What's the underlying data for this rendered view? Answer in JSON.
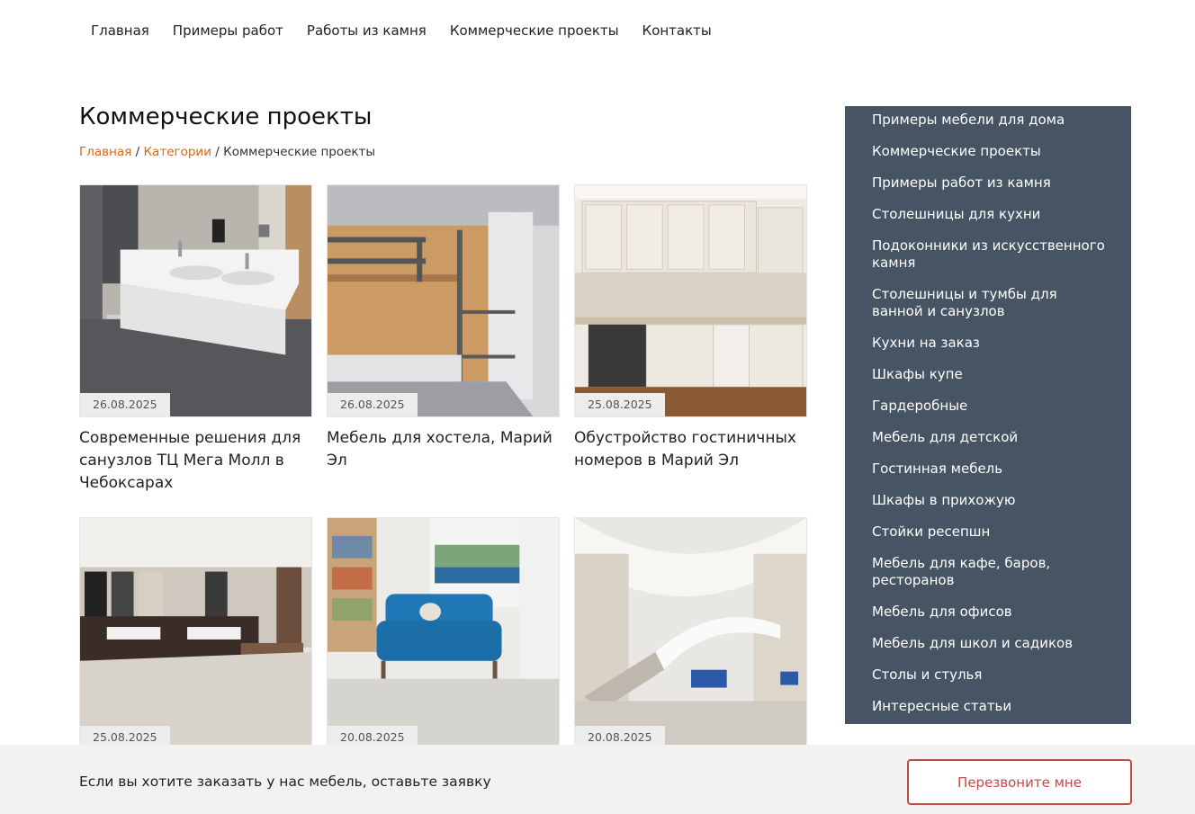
{
  "nav": [
    "Главная",
    "Примеры работ",
    "Работы из камня",
    "Коммерческие проекты",
    "Контакты"
  ],
  "page_title": "Коммерческие проекты",
  "breadcrumb": {
    "home": "Главная",
    "sep1": "/",
    "categories": "Категории",
    "sep2": "/",
    "current": "Коммерческие проекты"
  },
  "cards": [
    {
      "date": "26.08.2025",
      "title": "Современные решения для санузлов ТЦ Мега Молл в Чебоксарах"
    },
    {
      "date": "26.08.2025",
      "title": "Мебель для хостела, Марий Эл"
    },
    {
      "date": "25.08.2025",
      "title": "Обустройство гостиничных номеров в Марий Эл"
    },
    {
      "date": "25.08.2025",
      "title": ""
    },
    {
      "date": "20.08.2025",
      "title": ""
    },
    {
      "date": "20.08.2025",
      "title": ""
    }
  ],
  "sidebar": [
    "Примеры мебели для дома",
    "Коммерческие проекты",
    "Примеры работ из камня",
    "Столешницы для кухни",
    "Подоконники из искусственного камня",
    "Столешницы и тумбы для ванной и санузлов",
    "Кухни на заказ",
    "Шкафы купе",
    "Гардеробные",
    "Мебель для детской",
    "Гостинная мебель",
    "Шкафы в прихожую",
    "Стойки ресепшн",
    "Мебель для кафе, баров, ресторанов",
    "Мебель для офисов",
    "Мебель для школ и садиков",
    "Столы и стулья",
    "Интересные статьи"
  ],
  "footer": {
    "text": "Если вы хотите заказать у нас мебель, оставьте заявку",
    "button": "Перезвоните мне"
  },
  "colors": {
    "sidebar_bg": "#465464",
    "link_accent": "#d2691e",
    "button_accent": "#c24a4a"
  }
}
